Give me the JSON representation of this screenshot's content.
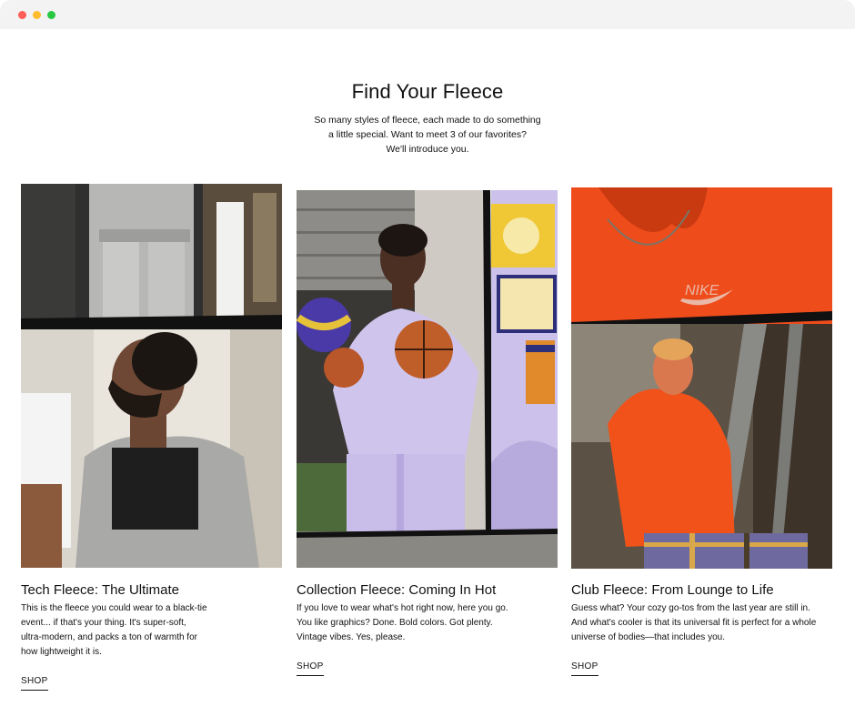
{
  "window": {
    "controls": [
      "close",
      "minimize",
      "zoom"
    ]
  },
  "header": {
    "title": "Find Your Fleece",
    "intro_line1": "So many styles of fleece, each made to do something",
    "intro_line2": "a little special. Want to meet 3 of our favorites?",
    "intro_line3": "We'll introduce you."
  },
  "cards": [
    {
      "title": "Tech Fleece: The Ultimate",
      "desc_line1": "This is the fleece you could wear to a black-tie",
      "desc_line2": "event... if that's your thing. It's super-soft,",
      "desc_line3": "ultra-modern, and packs a ton of warmth for",
      "desc_line4": "how lightweight it is.",
      "cta": "SHOP"
    },
    {
      "title": "Collection Fleece: Coming In Hot",
      "desc_line1": "If you love to wear what's hot right now, here you go.",
      "desc_line2": "You like graphics? Done. Bold colors. Got plenty.",
      "desc_line3": "Vintage vibes. Yes, please.",
      "cta": "SHOP"
    },
    {
      "title": "Club Fleece: From Lounge to Life",
      "desc_line1": "Guess what? Your cozy go-tos from the last year are still in.",
      "desc_line2": "And what's cooler is that its universal fit is perfect for a whole",
      "desc_line3": "universe of bodies—that includes you.",
      "cta": "SHOP"
    }
  ],
  "colors": {
    "club_orange": "#f2501e",
    "collection_lilac": "#c7bde6",
    "tech_grey": "#b9b9b7"
  }
}
